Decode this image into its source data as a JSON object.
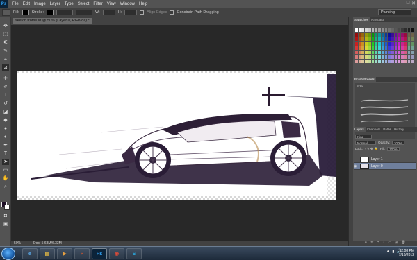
{
  "menubar": {
    "logo": "Ps",
    "items": [
      "File",
      "Edit",
      "Image",
      "Layer",
      "Type",
      "Select",
      "Filter",
      "View",
      "Window",
      "Help"
    ],
    "window_controls": [
      "–",
      "□",
      "✕"
    ]
  },
  "options": {
    "fill_label": "Fill:",
    "stroke_label": "Stroke:",
    "align_edges_label": "Align Edges",
    "constrain_label": "Constrain Path Dragging",
    "workspace": "Painting",
    "fill_color": "#000000",
    "stroke_color": "#000000"
  },
  "document": {
    "tab_title": "sketch trottle.M @ 50% (Layer 0, RGB/8#) *",
    "zoom": "50%",
    "doc_info": "Doc: 5.68M/6.33M"
  },
  "tools": {
    "foreground_color": "#1d0d25",
    "background_color": "#ffffff"
  },
  "panels": {
    "swatches_tab": "Swatches",
    "navigator_tab": "Navigator",
    "brush_presets_tab": "Brush Presets",
    "brush_size_label": "Size:",
    "layers_tab": "Layers",
    "channels_tab": "Channels",
    "paths_tab": "Paths",
    "history_tab": "History",
    "kind_label": "Kind",
    "blend_mode": "Normal",
    "opacity_label": "Opacity:",
    "opacity_value": "100%",
    "lock_label": "Lock:",
    "fill_label": "Fill:",
    "fill_value": "100%",
    "layers": [
      {
        "name": "Layer 1",
        "selected": false
      },
      {
        "name": "Layer 0",
        "selected": true
      }
    ]
  },
  "taskbar": {
    "clock_time": "12:08 PM",
    "clock_date": "7/16/2012"
  }
}
